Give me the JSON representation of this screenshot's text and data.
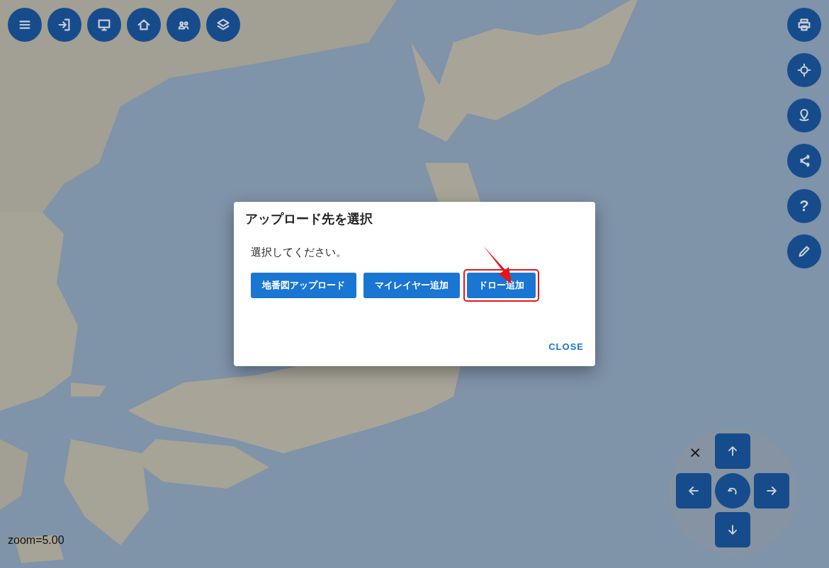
{
  "top_toolbar": [
    {
      "kind": "menu"
    },
    {
      "kind": "login"
    },
    {
      "kind": "monitor"
    },
    {
      "kind": "home"
    },
    {
      "kind": "people"
    },
    {
      "kind": "layers"
    }
  ],
  "right_toolbar": [
    {
      "kind": "print"
    },
    {
      "kind": "locate"
    },
    {
      "kind": "pin"
    },
    {
      "kind": "share"
    },
    {
      "kind": "help",
      "label": "?"
    },
    {
      "kind": "edit"
    }
  ],
  "dialog": {
    "title": "アップロード先を選択",
    "message": "選択してください。",
    "buttons": [
      {
        "label": "地番図アップロード",
        "highlighted": false
      },
      {
        "label": "マイレイヤー追加",
        "highlighted": false
      },
      {
        "label": "ドロー追加",
        "highlighted": true
      }
    ],
    "close": "CLOSE"
  },
  "nav_pad": {
    "close": "×",
    "keys": [
      {
        "kind": "up"
      },
      {
        "kind": "left"
      },
      {
        "kind": "reset"
      },
      {
        "kind": "right"
      },
      {
        "kind": "down"
      }
    ]
  },
  "zoom_label": "zoom=5.00"
}
